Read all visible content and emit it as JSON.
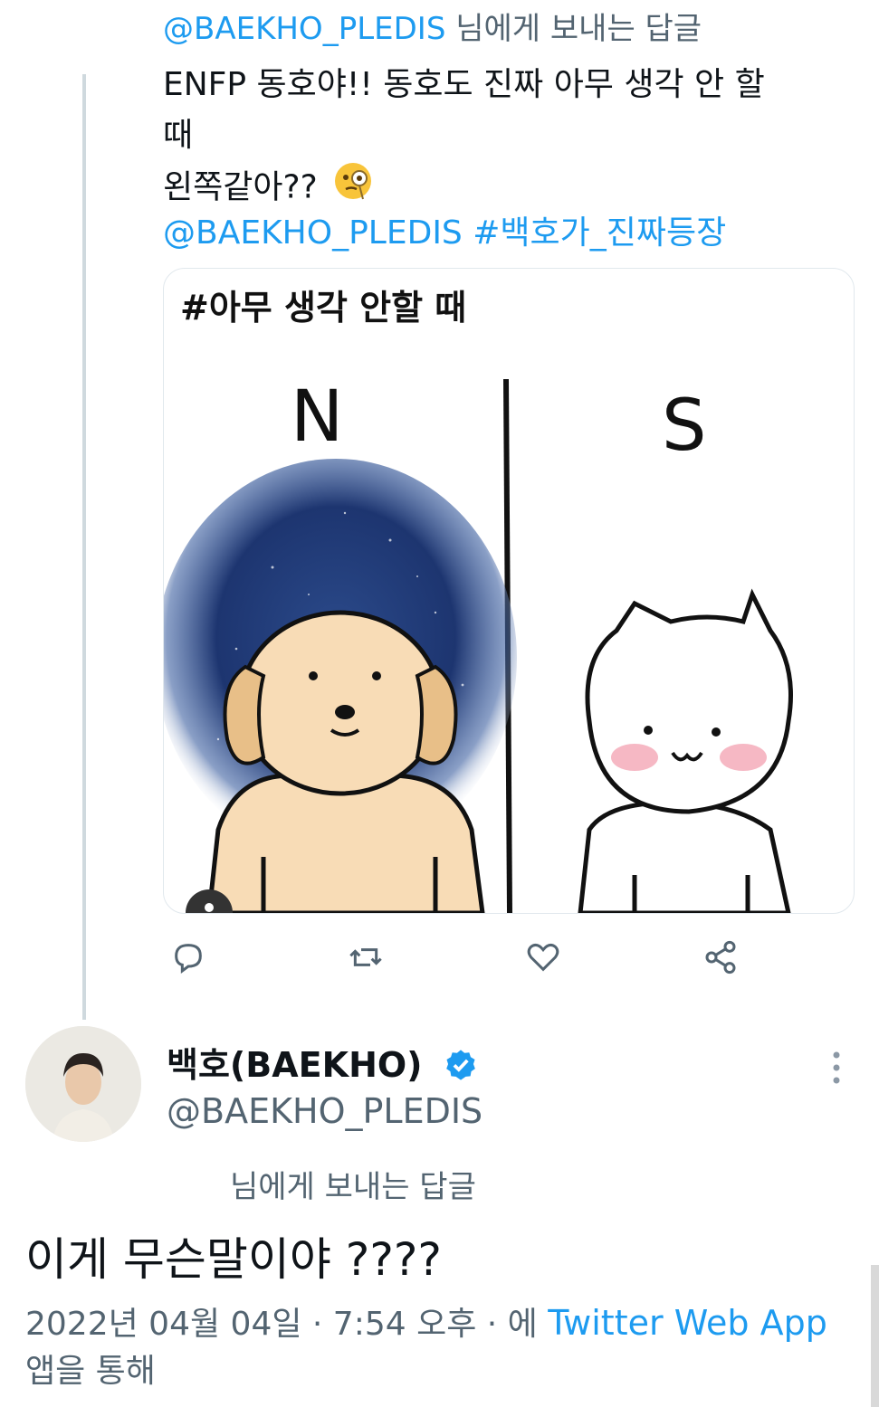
{
  "reply_header": {
    "handle": "@BAEKHO_PLEDIS",
    "suffix": "님에게 보내는 답글"
  },
  "tweet": {
    "line1": "ENFP 동호야!! 동호도 진짜 아무 생각 안 할 때",
    "line2": "왼쪽같아??",
    "emoji": "face-with-monocle",
    "mention": "@BAEKHO_PLEDIS",
    "hashtag": "#백호가_진짜등장"
  },
  "media": {
    "caption": "#아무 생각 안할 때",
    "left_label": "N",
    "right_label": "S"
  },
  "actions": [
    "reply-icon",
    "retweet-icon",
    "like-icon",
    "share-icon"
  ],
  "author": {
    "name": "백호(BAEKHO)",
    "handle": "@BAEKHO_PLEDIS",
    "verified": true
  },
  "reply_line": "님에게 보내는 답글",
  "main_text": "이게 무슨말이야 ????",
  "meta": {
    "timestamp": "2022년 04월 04일 · 7:54 오후 · 에",
    "app": "Twitter Web App",
    "suffix": "앱을 통해"
  },
  "colors": {
    "link": "#1d9bf0",
    "muted": "#536471",
    "text": "#0f1419"
  }
}
